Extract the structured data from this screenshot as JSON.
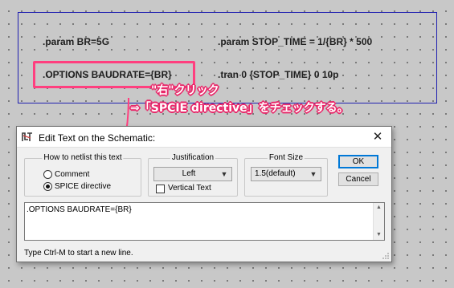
{
  "schematic": {
    "param_br": ".param BR=5G",
    "param_stop": ".param STOP_TIME = 1/{BR} * 500",
    "options": ".OPTIONS BAUDRATE={BR}",
    "tran": ".tran 0 {STOP_TIME} 0 10p"
  },
  "annotation": {
    "line1": "\"右\"クリック",
    "line2": "⇒「SPCIE directive」をチェックする。",
    "color": "#ff3f7f"
  },
  "dialog": {
    "title": "Edit Text on the Schematic:",
    "close_symbol": "✕",
    "netlist_group": {
      "label": "How to netlist this text",
      "options": [
        "Comment",
        "SPICE directive"
      ],
      "selected": "SPICE directive"
    },
    "justification": {
      "label": "Justification",
      "value": "Left",
      "vertical_text_label": "Vertical Text",
      "vertical_text_checked": false
    },
    "font_size": {
      "label": "Font Size",
      "value": "1.5(default)"
    },
    "ok_label": "OK",
    "cancel_label": "Cancel",
    "text_value": ".OPTIONS BAUDRATE={BR}",
    "hint": "Type Ctrl-M to start a new line."
  },
  "icons": {
    "app": "ltspice-icon",
    "close": "close-icon",
    "chevron": "chevron-down-icon"
  }
}
